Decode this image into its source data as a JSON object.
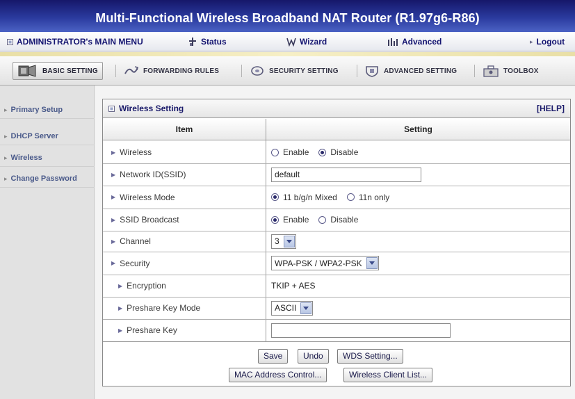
{
  "title": "Multi-Functional Wireless Broadband NAT Router (R1.97g6-R86)",
  "top_menu": {
    "admin_menu": "ADMINISTRATOR's MAIN MENU",
    "status": "Status",
    "wizard": "Wizard",
    "advanced": "Advanced",
    "logout": "Logout"
  },
  "tabs": [
    {
      "label": "BASIC SETTING",
      "active": true
    },
    {
      "label": "FORWARDING RULES",
      "active": false
    },
    {
      "label": "SECURITY SETTING",
      "active": false
    },
    {
      "label": "ADVANCED SETTING",
      "active": false
    },
    {
      "label": "TOOLBOX",
      "active": false
    }
  ],
  "sidebar": {
    "items": [
      {
        "label": "Primary Setup"
      },
      {
        "label": "DHCP Server"
      },
      {
        "label": "Wireless"
      },
      {
        "label": "Change Password"
      }
    ]
  },
  "panel": {
    "title": "Wireless Setting",
    "help": "[HELP]",
    "col_item": "Item",
    "col_setting": "Setting"
  },
  "rows": {
    "wireless": {
      "label": "Wireless",
      "opt1": "Enable",
      "opt2": "Disable",
      "selected": "Disable"
    },
    "ssid": {
      "label": "Network ID(SSID)",
      "value": "default"
    },
    "mode": {
      "label": "Wireless Mode",
      "opt1": "11 b/g/n Mixed",
      "opt2": "11n only",
      "selected": "11 b/g/n Mixed"
    },
    "ssid_broadcast": {
      "label": "SSID Broadcast",
      "opt1": "Enable",
      "opt2": "Disable",
      "selected": "Enable"
    },
    "channel": {
      "label": "Channel",
      "value": "3"
    },
    "security": {
      "label": "Security",
      "value": "WPA-PSK / WPA2-PSK"
    },
    "encryption": {
      "label": "Encryption",
      "value": "TKIP + AES"
    },
    "key_mode": {
      "label": "Preshare Key Mode",
      "value": "ASCII"
    },
    "key": {
      "label": "Preshare Key",
      "value": ""
    }
  },
  "buttons": {
    "save": "Save",
    "undo": "Undo",
    "wds": "WDS Setting...",
    "mac": "MAC Address Control...",
    "client_list": "Wireless Client List..."
  },
  "colors": {
    "banner_top": "#16176a",
    "banner_bottom": "#4b62c4",
    "menu_text": "#141470",
    "sidebar_text": "#4a5a8a"
  }
}
